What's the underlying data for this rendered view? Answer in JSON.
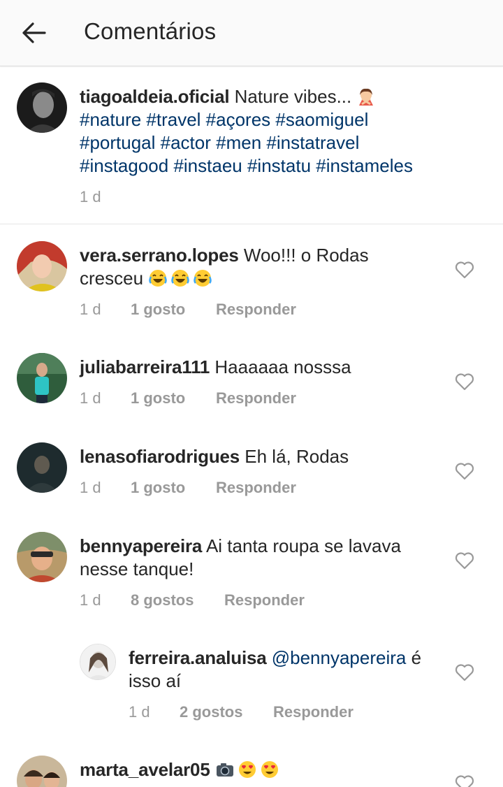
{
  "header": {
    "title": "Comentários"
  },
  "caption": {
    "username": "tiagoaldeia.oficial",
    "text": "Nature vibes...",
    "tags_line1": "#nature #travel #açores #saomiguel",
    "tags_line2": "#portugal #actor #men #instatravel",
    "tags_line3": "#instagood #instaeu #instatu #instameles",
    "time": "1 d"
  },
  "comments": [
    {
      "username": "vera.serrano.lopes",
      "text_line1": "Woo!!! o Rodas",
      "text_line2": "cresceu",
      "time": "1 d",
      "likes": "1 gosto",
      "reply": "Responder"
    },
    {
      "username": "juliabarreira111",
      "text_line1": "Haaaaaa nosssa",
      "time": "1 d",
      "likes": "1 gosto",
      "reply": "Responder"
    },
    {
      "username": "lenasofiarodrigues",
      "text_line1": "Eh lá, Rodas",
      "time": "1 d",
      "likes": "1 gosto",
      "reply": "Responder"
    },
    {
      "username": "bennyapereira",
      "text_line1": "Ai tanta roupa se lavava",
      "text_line2": "nesse tanque!",
      "time": "1 d",
      "likes": "8 gostos",
      "reply": "Responder"
    },
    {
      "username": "ferreira.analuisa",
      "mention": "@bennyapereira",
      "text_line1_tail": "é",
      "text_line2": "isso aí",
      "time": "1 d",
      "likes": "2 gostos",
      "reply": "Responder"
    },
    {
      "username": "marta_avelar05"
    }
  ],
  "icons": {
    "back": "arrow-left-icon",
    "heart": "heart-outline-icon",
    "emoji_caption": "person-gesturing-no-emoji",
    "emoji_laugh": "face-with-tears-of-joy-emoji",
    "emoji_camera": "camera-emoji",
    "emoji_heart_eyes": "heart-eyes-emoji"
  },
  "colors": {
    "hashtag": "#003569",
    "meta": "#999999",
    "text": "#262626",
    "appbar": "#fafafa"
  }
}
